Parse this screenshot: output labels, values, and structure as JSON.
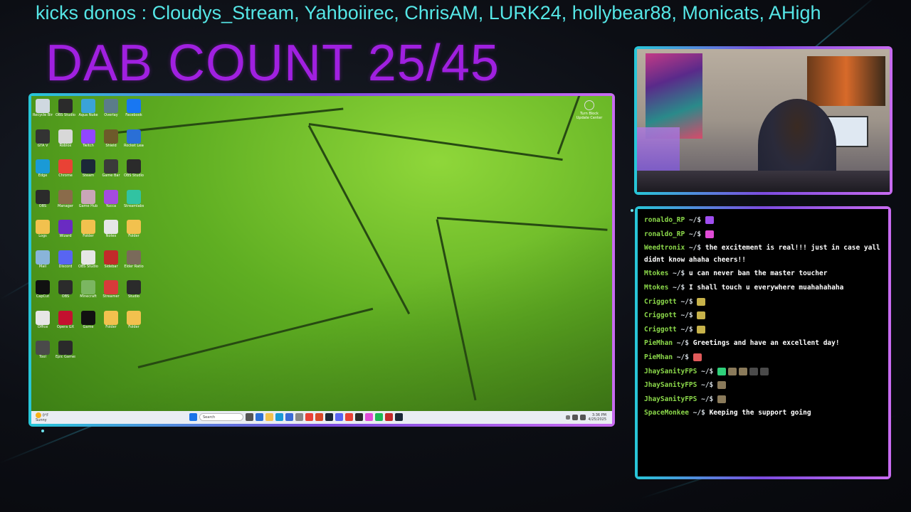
{
  "ticker": {
    "text": "kicks donos : Cloudys_Stream, Yahboiirec, ChrisAM, LURK24, hollybear88, Monicats, AHigh"
  },
  "overlay": {
    "dab_count": "DAB COUNT 25/45"
  },
  "desktop": {
    "icons": [
      {
        "label": "Recycle Bin",
        "color": "#cfd8e0"
      },
      {
        "label": "OBS Studio",
        "color": "#2b2b2b"
      },
      {
        "label": "Aqua Nuke",
        "color": "#3aa3d8"
      },
      {
        "label": "Overlay",
        "color": "#5b7c8a"
      },
      {
        "label": "Facebook",
        "color": "#1877f2"
      },
      {
        "label": "GTA V",
        "color": "#333333"
      },
      {
        "label": "Roblox",
        "color": "#d8d8d8"
      },
      {
        "label": "Twitch",
        "color": "#9146ff"
      },
      {
        "label": "Shield",
        "color": "#6d5a2a"
      },
      {
        "label": "Rocket League",
        "color": "#2a6fd6"
      },
      {
        "label": "Edge",
        "color": "#1a9ad6"
      },
      {
        "label": "Chrome",
        "color": "#e94235"
      },
      {
        "label": "Steam",
        "color": "#1b2838"
      },
      {
        "label": "Game Bar",
        "color": "#3a3a3a"
      },
      {
        "label": "OBS Studio",
        "color": "#2b2b2b"
      },
      {
        "label": "OBS",
        "color": "#2b2b2b"
      },
      {
        "label": "Manager",
        "color": "#8a6b4a"
      },
      {
        "label": "Game Hub",
        "color": "#c9a6b8"
      },
      {
        "label": "Yucca",
        "color": "#a44be0"
      },
      {
        "label": "Streamlabs",
        "color": "#31c3a2"
      },
      {
        "label": "Logs",
        "color": "#f2c14e"
      },
      {
        "label": "Wizard",
        "color": "#6a2bc2"
      },
      {
        "label": "Folder",
        "color": "#f2c14e"
      },
      {
        "label": "Notes",
        "color": "#e6e6e6"
      },
      {
        "label": "Folder",
        "color": "#f2c14e"
      },
      {
        "label": "Mail",
        "color": "#89b4d9"
      },
      {
        "label": "Discord",
        "color": "#5865f2"
      },
      {
        "label": "OBS Studio",
        "color": "#e6e6e6"
      },
      {
        "label": "Sidebar",
        "color": "#c22a2a"
      },
      {
        "label": "Elder Ratio",
        "color": "#7a6a5a"
      },
      {
        "label": "CapCut",
        "color": "#111111"
      },
      {
        "label": "OBS",
        "color": "#2b2b2b"
      },
      {
        "label": "Minecraft",
        "color": "#7bb661"
      },
      {
        "label": "Streamer",
        "color": "#d83a3a"
      },
      {
        "label": "Studio",
        "color": "#2b2b2b"
      },
      {
        "label": "Office",
        "color": "#e6e6e6"
      },
      {
        "label": "Opera GX",
        "color": "#c4102f"
      },
      {
        "label": "Game",
        "color": "#111111"
      },
      {
        "label": "Folder",
        "color": "#f2c14e"
      },
      {
        "label": "Folder",
        "color": "#f2c14e"
      },
      {
        "label": "Tool",
        "color": "#4a4a4a"
      },
      {
        "label": "Epic Games",
        "color": "#2a2a2a"
      }
    ],
    "recycle_label": "Turn Block Update Center",
    "taskbar": {
      "weather_temp": "0°F",
      "weather_desc": "Sunny",
      "search_placeholder": "Search",
      "time": "3:36 PM",
      "date": "4/25/2025"
    }
  },
  "chat": {
    "messages": [
      {
        "user": "ronaldo_RP",
        "prompt": "~/$",
        "text": "",
        "emotes": [
          "#a04ef0"
        ]
      },
      {
        "user": "ronaldo_RP",
        "prompt": "~/$",
        "text": "",
        "emotes": [
          "#e04bd6"
        ]
      },
      {
        "user": "Weedtronix",
        "prompt": "~/$",
        "text": "the excitement is real!!! just in case yall didnt know ahaha cheers!!",
        "emotes": []
      },
      {
        "user": "Mtokes",
        "prompt": "~/$",
        "text": "u can never ban the master toucher",
        "emotes": []
      },
      {
        "user": "Mtokes",
        "prompt": "~/$",
        "text": "I shall touch u everywhere muahahahaha",
        "emotes": []
      },
      {
        "user": "Criggott",
        "prompt": "~/$",
        "text": "",
        "emotes": [
          "#c7b24a"
        ]
      },
      {
        "user": "Criggott",
        "prompt": "~/$",
        "text": "",
        "emotes": [
          "#c7b24a"
        ]
      },
      {
        "user": "Criggott",
        "prompt": "~/$",
        "text": "",
        "emotes": [
          "#c7b24a"
        ]
      },
      {
        "user": "PieMhan",
        "prompt": "~/$",
        "text": "Greetings and have an excellent day!",
        "emotes": []
      },
      {
        "user": "PieMhan",
        "prompt": "~/$",
        "text": "",
        "emotes": [
          "#e05a5a"
        ]
      },
      {
        "user": "JhaySanityFPS",
        "prompt": "~/$",
        "text": "",
        "emotes": [
          "#2fd07a",
          "#8a7a5a",
          "#8a7a5a",
          "#4a4a4a",
          "#4a4a4a"
        ]
      },
      {
        "user": "JhaySanityFPS",
        "prompt": "~/$",
        "text": "",
        "emotes": [
          "#8a7a5a"
        ]
      },
      {
        "user": "JhaySanityFPS",
        "prompt": "~/$",
        "text": "",
        "emotes": [
          "#8a7a5a"
        ]
      },
      {
        "user": "SpaceMonkee",
        "prompt": "~/$",
        "text": "Keeping the support going",
        "emotes": []
      }
    ]
  },
  "colors": {
    "ticker": "#55e6e6",
    "dab_count": "#a020e0",
    "frame_start": "#27c7d8",
    "frame_end": "#c86bf0",
    "chat_username": "#8bd84a"
  }
}
